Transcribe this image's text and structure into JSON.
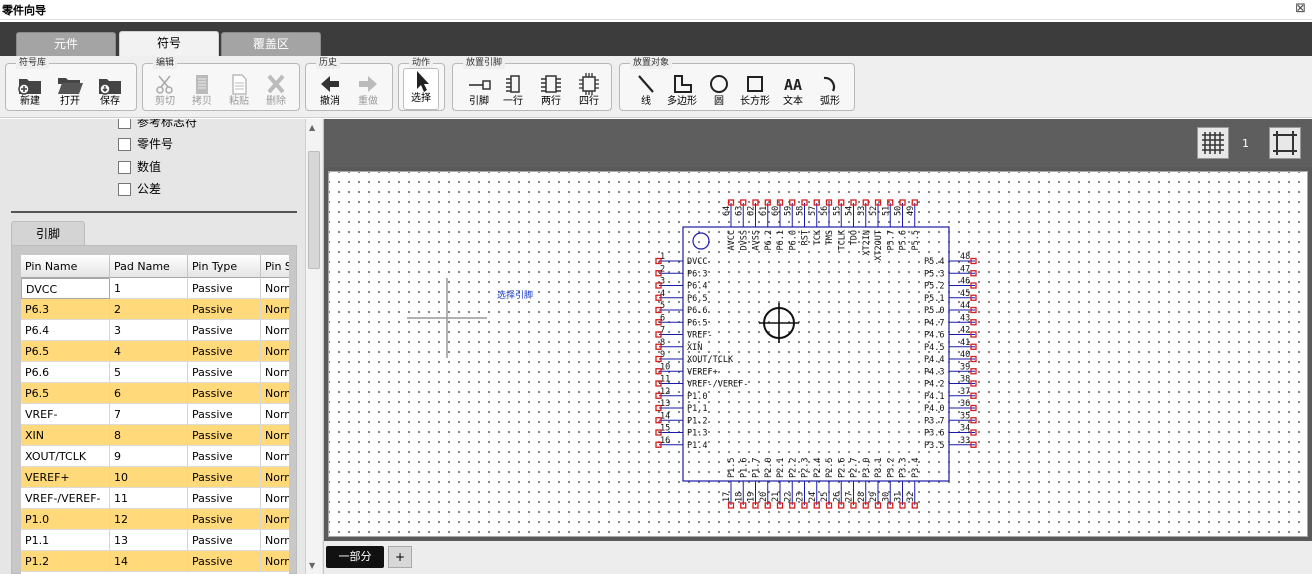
{
  "window": {
    "title": "零件向导",
    "close_glyph": "⊠"
  },
  "tabs": [
    {
      "label": "元件"
    },
    {
      "label": "符号"
    },
    {
      "label": "覆盖区"
    }
  ],
  "active_tab": "符号",
  "toolbar": {
    "groups": [
      {
        "title": "符号库",
        "buttons": [
          {
            "label": "新建",
            "icon": "new-icon"
          },
          {
            "label": "打开",
            "icon": "open-folder-icon"
          },
          {
            "label": "保存",
            "icon": "save-icon"
          }
        ]
      },
      {
        "title": "编辑",
        "buttons": [
          {
            "label": "剪切",
            "icon": "cut-icon",
            "disabled": true
          },
          {
            "label": "拷贝",
            "icon": "copy-icon",
            "disabled": true
          },
          {
            "label": "粘贴",
            "icon": "paste-icon",
            "disabled": true
          },
          {
            "label": "删除",
            "icon": "delete-icon",
            "disabled": true
          }
        ]
      },
      {
        "title": "历史",
        "buttons": [
          {
            "label": "撤消",
            "icon": "undo-icon"
          },
          {
            "label": "重做",
            "icon": "redo-icon",
            "disabled": true
          }
        ]
      },
      {
        "title": "动作",
        "buttons": [
          {
            "label": "选择",
            "icon": "pointer-icon",
            "selected": true
          }
        ]
      },
      {
        "title": "放置引脚",
        "buttons": [
          {
            "label": "引脚",
            "icon": "pin-icon"
          },
          {
            "label": "一行",
            "icon": "one-row-icon"
          },
          {
            "label": "两行",
            "icon": "two-rows-icon"
          },
          {
            "label": "四行",
            "icon": "four-rows-icon"
          }
        ]
      },
      {
        "title": "放置对象",
        "buttons": [
          {
            "label": "线",
            "icon": "line-icon"
          },
          {
            "label": "多边形",
            "icon": "polygon-icon"
          },
          {
            "label": "圆",
            "icon": "circle-icon"
          },
          {
            "label": "长方形",
            "icon": "rectangle-icon"
          },
          {
            "label": "文本",
            "icon": "text-icon",
            "glyph": "AA"
          },
          {
            "label": "弧形",
            "icon": "arc-icon"
          }
        ]
      }
    ]
  },
  "left_panel": {
    "checkboxes": [
      {
        "label": "参考标志符",
        "checked": false
      },
      {
        "label": "零件号",
        "checked": false
      },
      {
        "label": "数值",
        "checked": false
      },
      {
        "label": "公差",
        "checked": false
      }
    ],
    "pins_tab_label": "引脚",
    "pins_table": {
      "columns": [
        "Pin Name",
        "Pad Name",
        "Pin Type",
        "Pin Style"
      ],
      "rows": [
        [
          "DVCC",
          "1",
          "Passive",
          "Normal"
        ],
        [
          "P6.3",
          "2",
          "Passive",
          "Normal"
        ],
        [
          "P6.4",
          "3",
          "Passive",
          "Normal"
        ],
        [
          "P6.5",
          "4",
          "Passive",
          "Normal"
        ],
        [
          "P6.6",
          "5",
          "Passive",
          "Normal"
        ],
        [
          "P6.5",
          "6",
          "Passive",
          "Normal"
        ],
        [
          "VREF-",
          "7",
          "Passive",
          "Normal"
        ],
        [
          "XIN",
          "8",
          "Passive",
          "Normal"
        ],
        [
          "XOUT/TCLK",
          "9",
          "Passive",
          "Normal"
        ],
        [
          "VEREF+",
          "10",
          "Passive",
          "Normal"
        ],
        [
          "VREF-/VEREF-",
          "11",
          "Passive",
          "Normal"
        ],
        [
          "P1.0",
          "12",
          "Passive",
          "Normal"
        ],
        [
          "P1.1",
          "13",
          "Passive",
          "Normal"
        ],
        [
          "P1.2",
          "14",
          "Passive",
          "Normal"
        ]
      ]
    }
  },
  "canvas": {
    "zoom_label": "1",
    "hint_text": "选择引脚",
    "ic": {
      "left_pins": [
        {
          "num": "1",
          "name": "DVCC"
        },
        {
          "num": "2",
          "name": "P6.3"
        },
        {
          "num": "3",
          "name": "P6.4"
        },
        {
          "num": "4",
          "name": "P6.5"
        },
        {
          "num": "5",
          "name": "P6.6"
        },
        {
          "num": "6",
          "name": "P6.5"
        },
        {
          "num": "7",
          "name": "VREF-"
        },
        {
          "num": "8",
          "name": "XIN"
        },
        {
          "num": "9",
          "name": "XOUT/TCLK"
        },
        {
          "num": "10",
          "name": "VEREF+"
        },
        {
          "num": "11",
          "name": "VREF-/VEREF-"
        },
        {
          "num": "12",
          "name": "P1.0"
        },
        {
          "num": "13",
          "name": "P1.1"
        },
        {
          "num": "14",
          "name": "P1.2"
        },
        {
          "num": "15",
          "name": "P1.3"
        },
        {
          "num": "16",
          "name": "P1.4"
        }
      ],
      "bottom_pins": [
        {
          "num": "17",
          "name": "P1.5"
        },
        {
          "num": "18",
          "name": "P1.6"
        },
        {
          "num": "19",
          "name": "P1.7"
        },
        {
          "num": "20",
          "name": "P2.0"
        },
        {
          "num": "21",
          "name": "P2.1"
        },
        {
          "num": "22",
          "name": "P2.2"
        },
        {
          "num": "23",
          "name": "P2.3"
        },
        {
          "num": "24",
          "name": "P2.4"
        },
        {
          "num": "25",
          "name": "P2.5"
        },
        {
          "num": "26",
          "name": "P2.6"
        },
        {
          "num": "27",
          "name": "P2.7"
        },
        {
          "num": "28",
          "name": "P3.0"
        },
        {
          "num": "29",
          "name": "P3.1"
        },
        {
          "num": "30",
          "name": "P3.2"
        },
        {
          "num": "31",
          "name": "P3.3"
        },
        {
          "num": "32",
          "name": "P3.4"
        }
      ],
      "right_pins": [
        {
          "num": "48",
          "name": "P5.4"
        },
        {
          "num": "47",
          "name": "P5.3"
        },
        {
          "num": "46",
          "name": "P5.2"
        },
        {
          "num": "45",
          "name": "P5.1"
        },
        {
          "num": "44",
          "name": "P5.0"
        },
        {
          "num": "43",
          "name": "P4.7"
        },
        {
          "num": "42",
          "name": "P4.6"
        },
        {
          "num": "41",
          "name": "P4.5"
        },
        {
          "num": "40",
          "name": "P4.4"
        },
        {
          "num": "39",
          "name": "P4.3"
        },
        {
          "num": "38",
          "name": "P4.2"
        },
        {
          "num": "37",
          "name": "P4.1"
        },
        {
          "num": "36",
          "name": "P4.0"
        },
        {
          "num": "35",
          "name": "P3.7"
        },
        {
          "num": "34",
          "name": "P3.6"
        },
        {
          "num": "33",
          "name": "P3.5"
        }
      ],
      "top_pins": [
        {
          "num": "64",
          "name": "AVCC"
        },
        {
          "num": "63",
          "name": "DVSS"
        },
        {
          "num": "62",
          "name": "AVSS"
        },
        {
          "num": "61",
          "name": "P6.2"
        },
        {
          "num": "60",
          "name": "P6.1"
        },
        {
          "num": "59",
          "name": "P6.0"
        },
        {
          "num": "58",
          "name": "RST"
        },
        {
          "num": "57",
          "name": "TCK"
        },
        {
          "num": "56",
          "name": "TMS"
        },
        {
          "num": "55",
          "name": "TCLK"
        },
        {
          "num": "54",
          "name": "TDO"
        },
        {
          "num": "53",
          "name": "XT2IN"
        },
        {
          "num": "52",
          "name": "XT2OUT"
        },
        {
          "num": "51",
          "name": "P5.7"
        },
        {
          "num": "50",
          "name": "P5.6"
        },
        {
          "num": "49",
          "name": "P5.5"
        }
      ]
    }
  },
  "bottom": {
    "part_tab": "一部分",
    "add_glyph": "+"
  },
  "colors": {
    "ic_outline": "#1a1aa8",
    "pin_end": "#d61c1c",
    "row_highlight": "#ffd97a"
  }
}
